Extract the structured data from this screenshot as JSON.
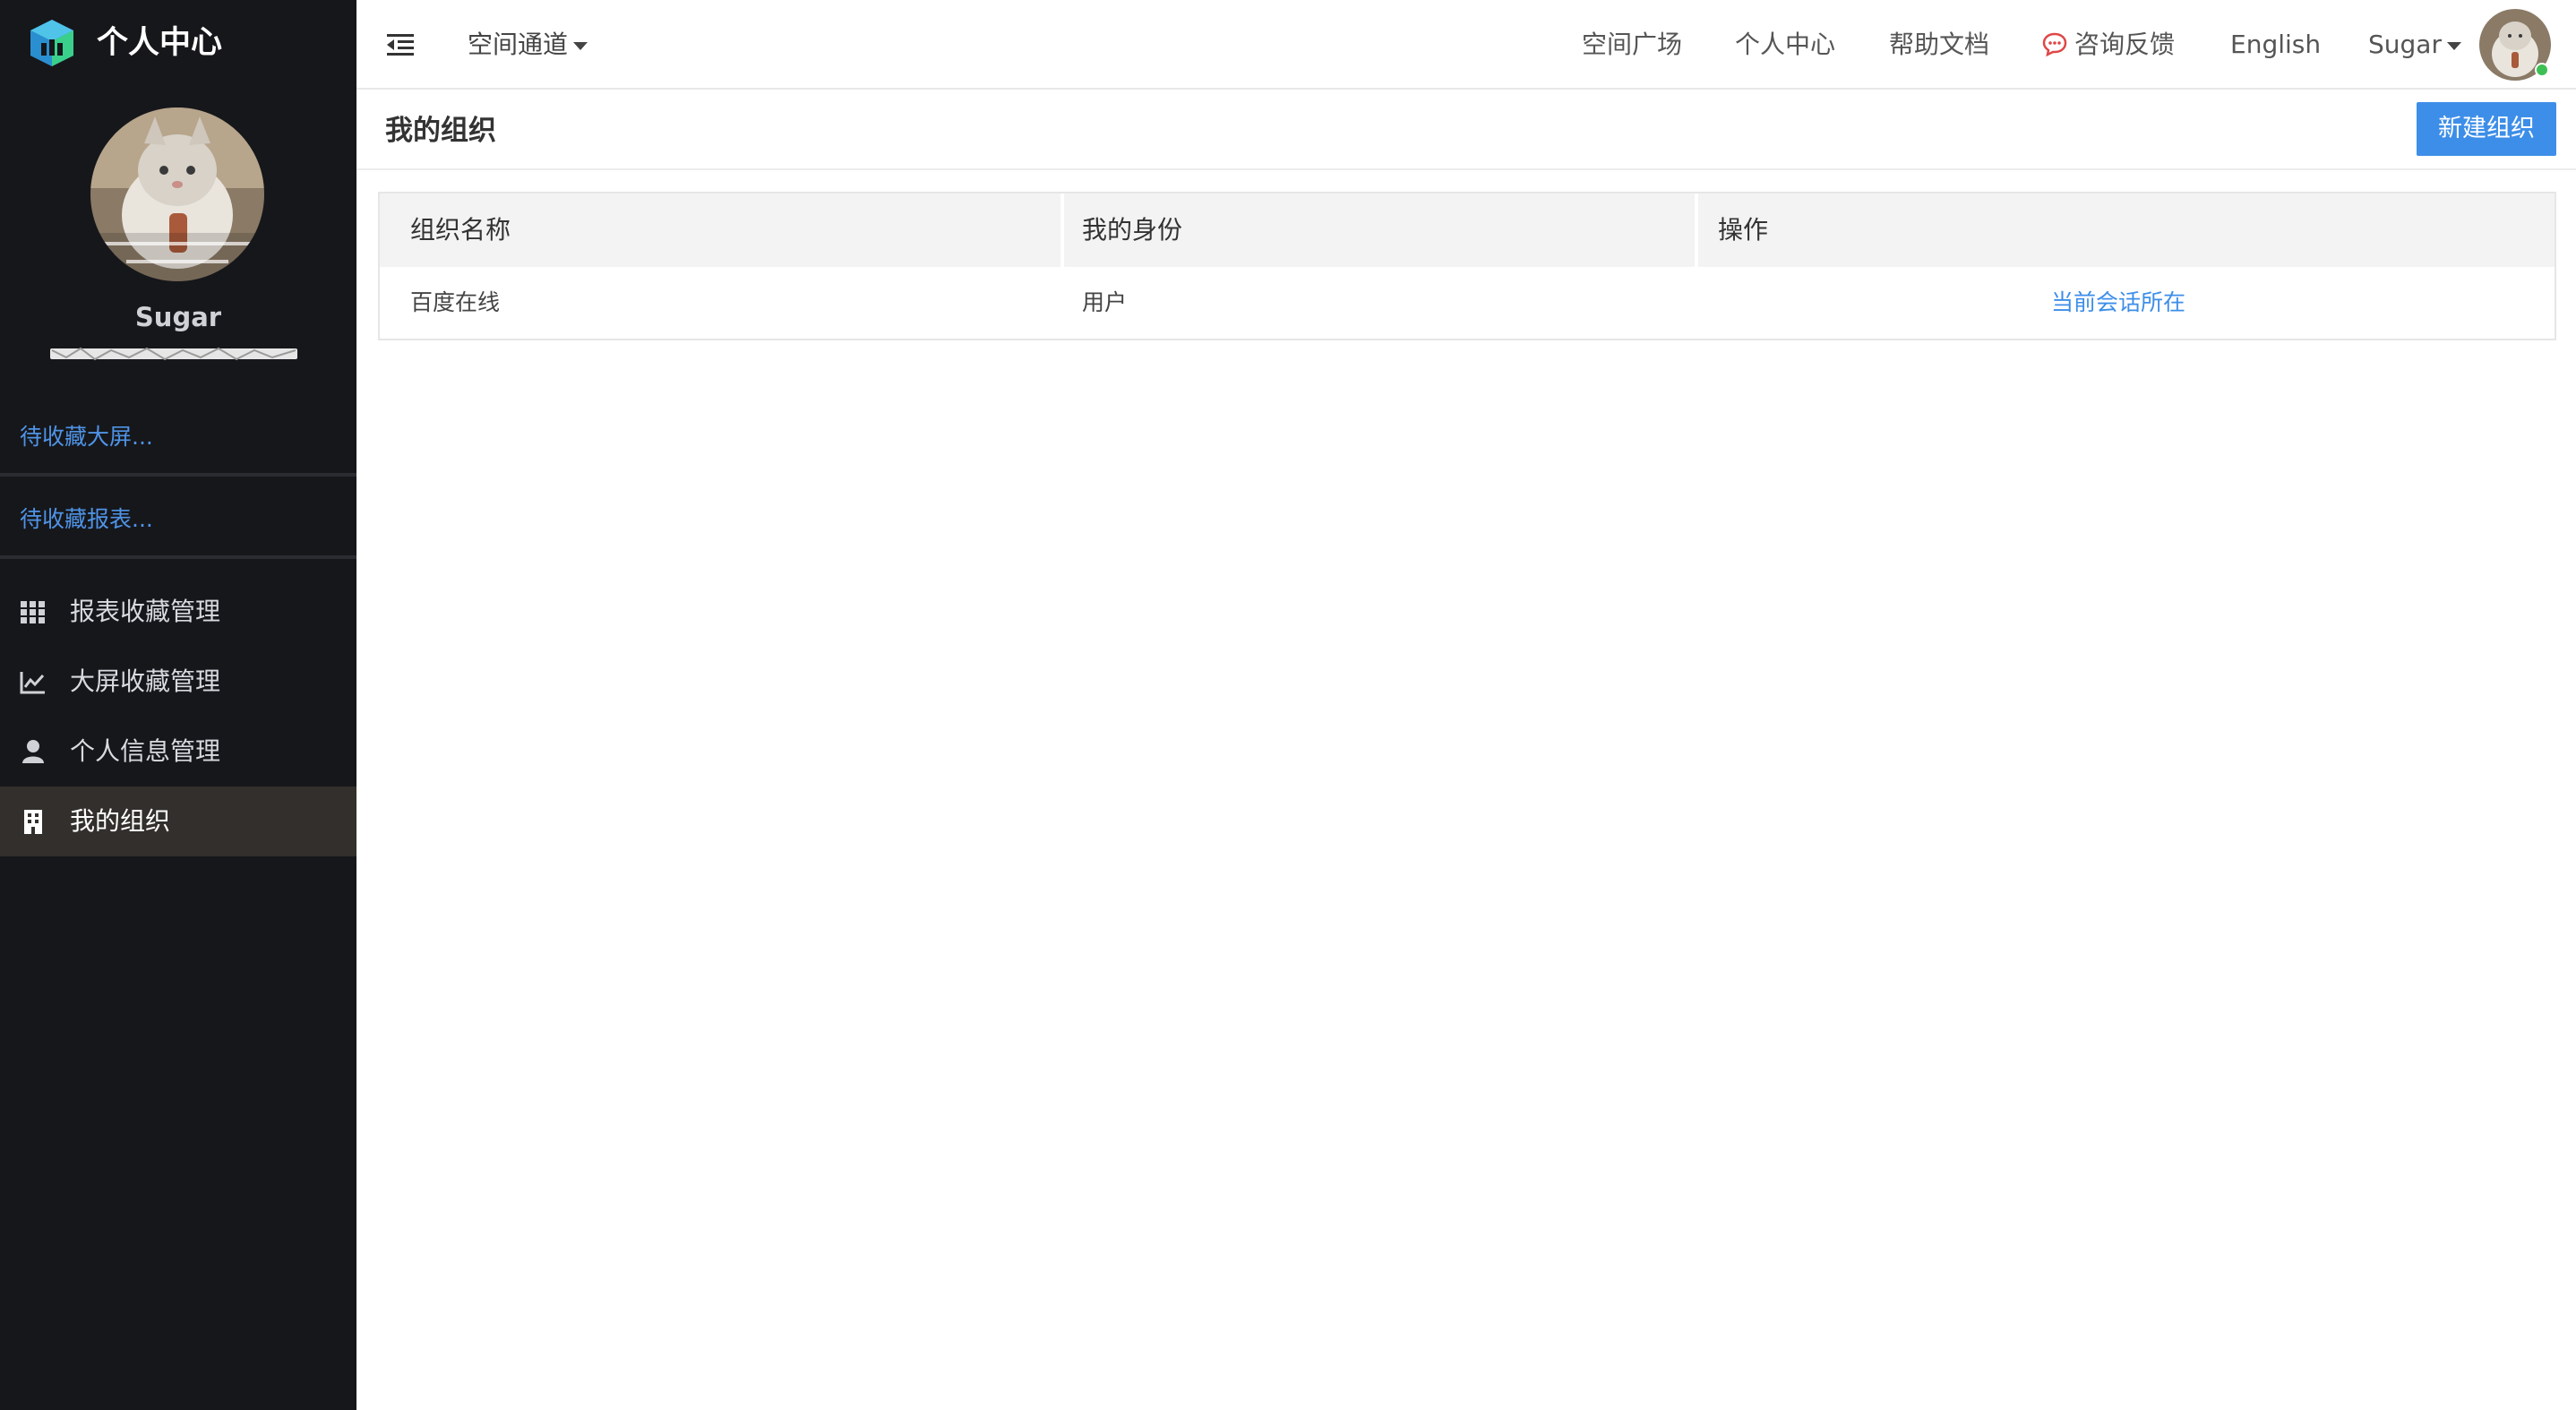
{
  "brand": {
    "title": "个人中心",
    "logo_icon": "cube-logo-icon",
    "accent": "#3aa8d8"
  },
  "profile": {
    "name": "Sugar",
    "avatar_icon": "cat-avatar"
  },
  "sidebar": {
    "favorites": [
      {
        "label": "待收藏大屏..."
      },
      {
        "label": "待收藏报表..."
      }
    ],
    "items": [
      {
        "label": "报表收藏管理",
        "icon": "grid-icon",
        "active": false
      },
      {
        "label": "大屏收藏管理",
        "icon": "chart-line-icon",
        "active": false
      },
      {
        "label": "个人信息管理",
        "icon": "user-icon",
        "active": false
      },
      {
        "label": "我的组织",
        "icon": "building-icon",
        "active": true
      }
    ]
  },
  "topbar": {
    "space_channel": "空间通道",
    "links": [
      {
        "label": "空间广场"
      },
      {
        "label": "个人中心"
      },
      {
        "label": "帮助文档"
      },
      {
        "label": "咨询反馈",
        "icon": "chat-bubble-icon"
      },
      {
        "label": "English"
      },
      {
        "label": "Sugar"
      }
    ]
  },
  "content": {
    "title": "我的组织",
    "new_button": "新建组织",
    "table": {
      "headers": [
        "组织名称",
        "我的身份",
        "操作"
      ],
      "rows": [
        {
          "name": "百度在线",
          "role": "用户",
          "action": "当前会话所在"
        }
      ]
    }
  },
  "colors": {
    "sidebar_bg": "#16171b",
    "link_blue": "#3d8ee8",
    "online": "#3cc054"
  }
}
